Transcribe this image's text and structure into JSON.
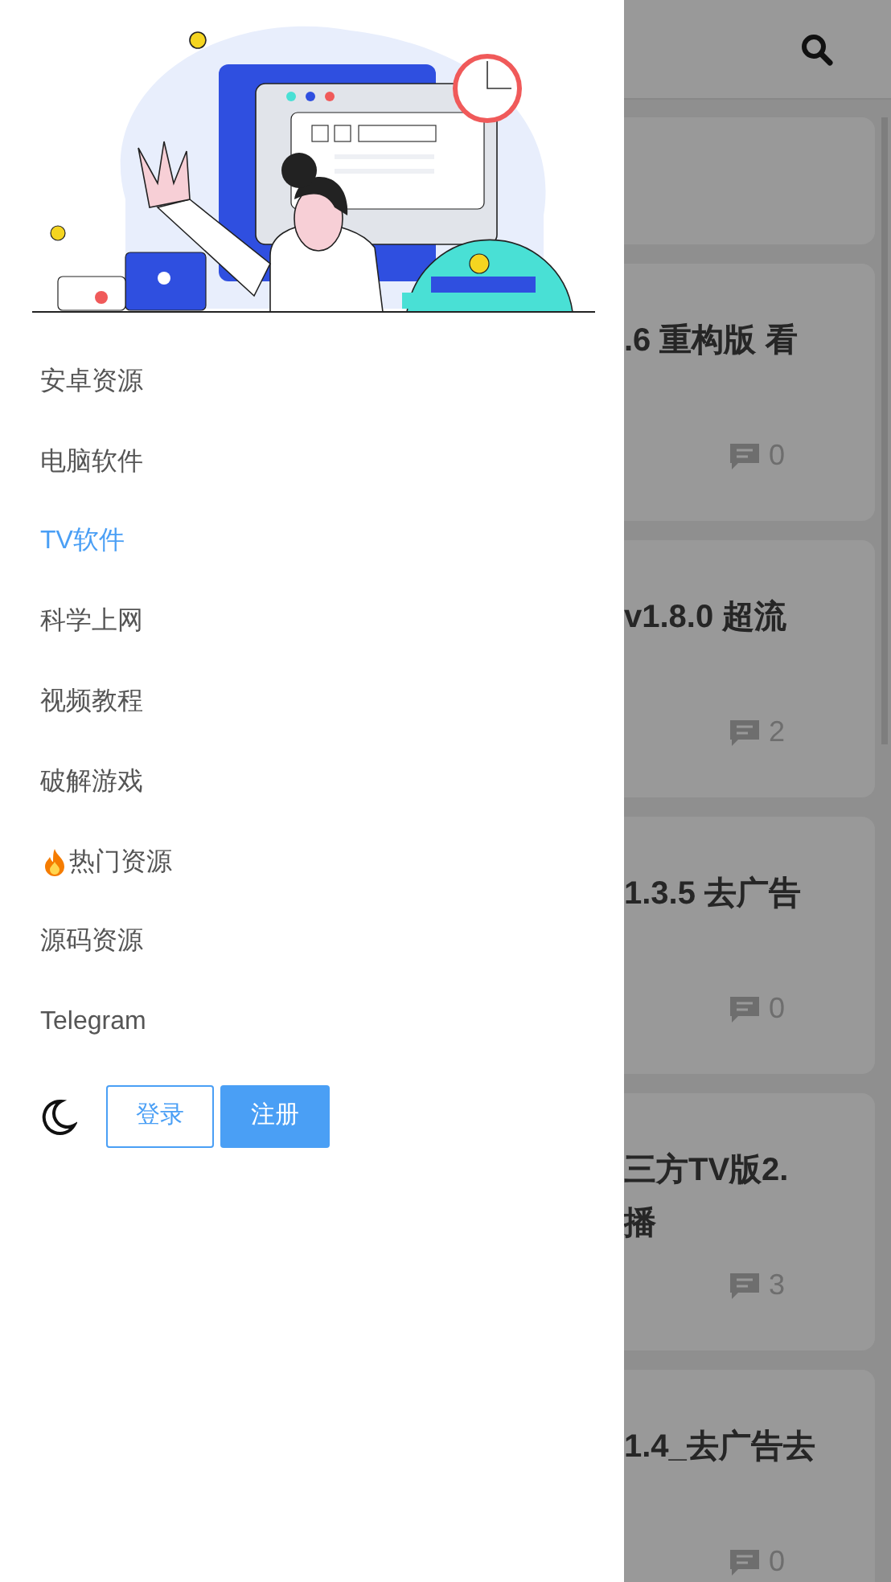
{
  "drawer": {
    "menu": [
      {
        "label": "安卓资源",
        "selected": false,
        "kind": "plain"
      },
      {
        "label": "电脑软件",
        "selected": false,
        "kind": "plain"
      },
      {
        "label": "TV软件",
        "selected": true,
        "kind": "plain"
      },
      {
        "label": "科学上网",
        "selected": false,
        "kind": "plain"
      },
      {
        "label": "视频教程",
        "selected": false,
        "kind": "plain"
      },
      {
        "label": "破解游戏",
        "selected": false,
        "kind": "plain"
      },
      {
        "label": "热门资源",
        "selected": false,
        "kind": "hot"
      },
      {
        "label": "源码资源",
        "selected": false,
        "kind": "plain"
      },
      {
        "label": "Telegram",
        "selected": false,
        "kind": "plain"
      }
    ],
    "login_button": "登录",
    "register_button": "注册"
  },
  "posts": [
    {
      "title_lines": [
        ".6 重构版 看"
      ],
      "comments": "0"
    },
    {
      "title_lines": [
        "v1.8.0 超流"
      ],
      "comments": "2"
    },
    {
      "title_lines": [
        "1.3.5 去广告"
      ],
      "comments": "0"
    },
    {
      "title_lines": [
        "三方TV版2.",
        "播"
      ],
      "comments": "3"
    },
    {
      "title_lines": [
        "1.4_去广告去"
      ],
      "comments": "0"
    }
  ]
}
